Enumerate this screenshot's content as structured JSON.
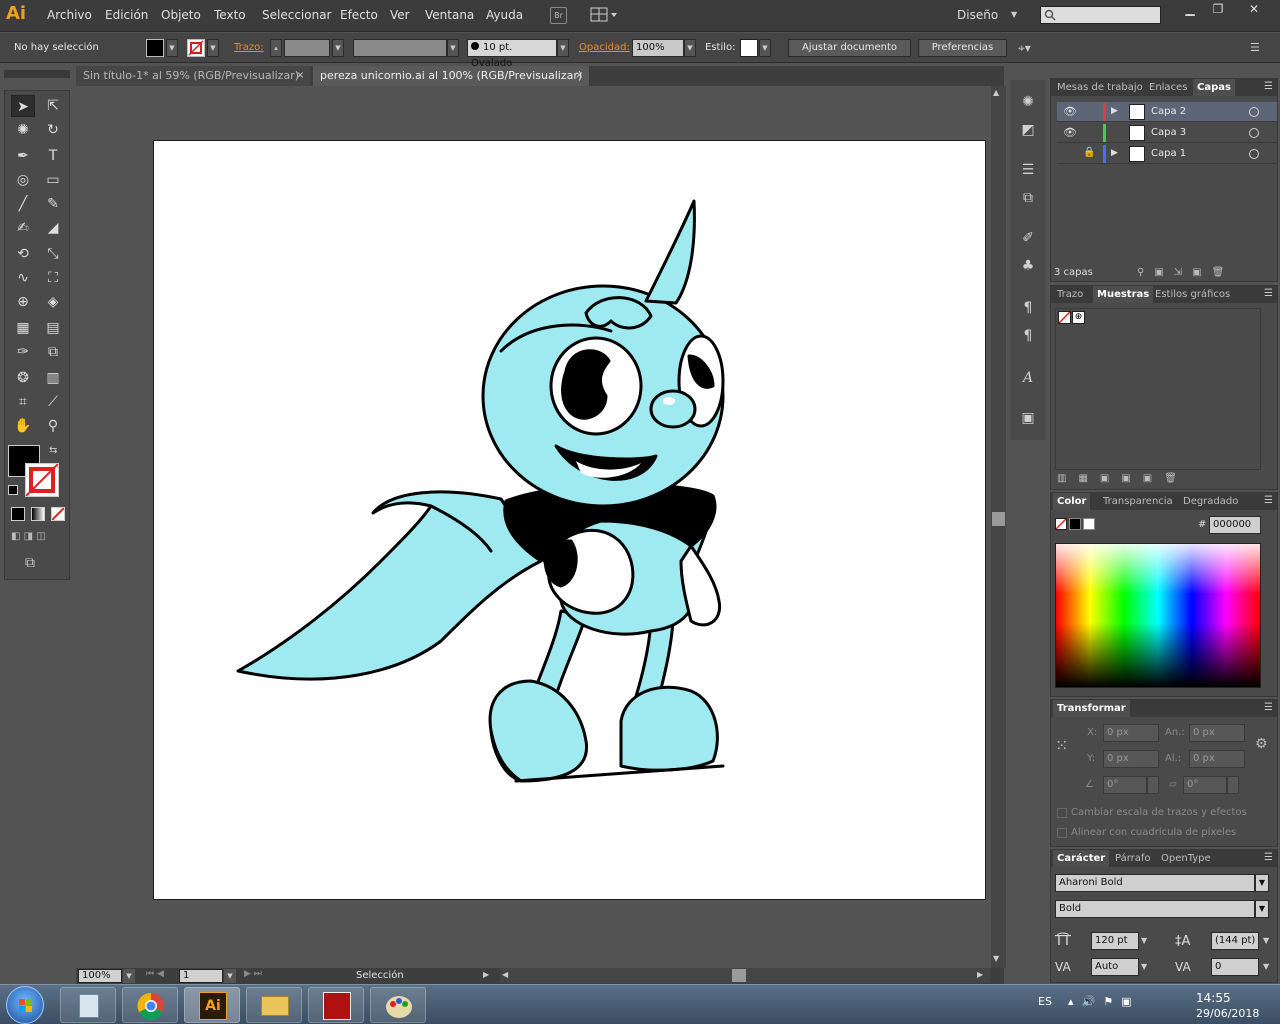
{
  "app": {
    "logo": "Ai",
    "menu": [
      "Archivo",
      "Edición",
      "Objeto",
      "Texto",
      "Seleccionar",
      "Efecto",
      "Ver",
      "Ventana",
      "Ayuda"
    ],
    "bridge_label": "Br",
    "workspace": "Diseño",
    "search_placeholder": ""
  },
  "control_bar": {
    "selection_status": "No hay selección",
    "stroke_label": "Trazo:",
    "brush_label": "10 pt. Ovalado",
    "opacity_label": "Opacidad:",
    "opacity_value": "100%",
    "style_label": "Estilo:",
    "adjust_doc_button": "Ajustar documento",
    "prefs_button": "Preferencias"
  },
  "tabs": [
    {
      "label": "Sin título-1* al 59% (RGB/Previsualizar)",
      "close": "×"
    },
    {
      "label": "pereza unicornio.ai al 100% (RGB/Previsualizar)",
      "close": "×"
    }
  ],
  "status_bar": {
    "zoom": "100%",
    "artboard_num": "1",
    "tool_status": "Selección"
  },
  "layers_panel": {
    "tabs": [
      "Mesas de trabajo",
      "Enlaces",
      "Capas"
    ],
    "layers": [
      {
        "name": "Capa 2",
        "color": "#e8364a"
      },
      {
        "name": "Capa 3",
        "color": "#3bd14b"
      },
      {
        "name": "Capa 1",
        "color": "#4a6cf0"
      }
    ],
    "count": "3 capas"
  },
  "swatches_panel": {
    "tabs": [
      "Trazo",
      "Muestras",
      "Estilos gráficos"
    ]
  },
  "color_panel": {
    "tabs": [
      "Color",
      "Transparencia",
      "Degradado"
    ],
    "hash": "#",
    "hex_value": "000000"
  },
  "transform_panel": {
    "title": "Transformar",
    "x_label": "X:",
    "x_value": "0 px",
    "y_label": "Y:",
    "y_value": "0 px",
    "w_label": "An.:",
    "w_value": "0 px",
    "h_label": "Al.:",
    "h_value": "0 px",
    "rot_value": "0°",
    "shear_value": "0°",
    "scale_strokes": "Cambiar escala de trazos y efectos",
    "align_pixel": "Alinear con cuadrícula de píxeles"
  },
  "character_panel": {
    "tabs": [
      "Carácter",
      "Párrafo",
      "OpenType"
    ],
    "font_family": "Aharoni Bold",
    "font_style": "Bold",
    "size": "120 pt",
    "leading": "(144 pt)",
    "kerning": "Auto",
    "tracking": "0"
  },
  "taskbar": {
    "language": "ES",
    "time": "14:55",
    "date": "29/06/2018",
    "ai_label": "Ai"
  },
  "colors": {
    "character_fill": "#9eeaf0",
    "character_line": "#000000",
    "ai_orange": "#f0a020"
  }
}
